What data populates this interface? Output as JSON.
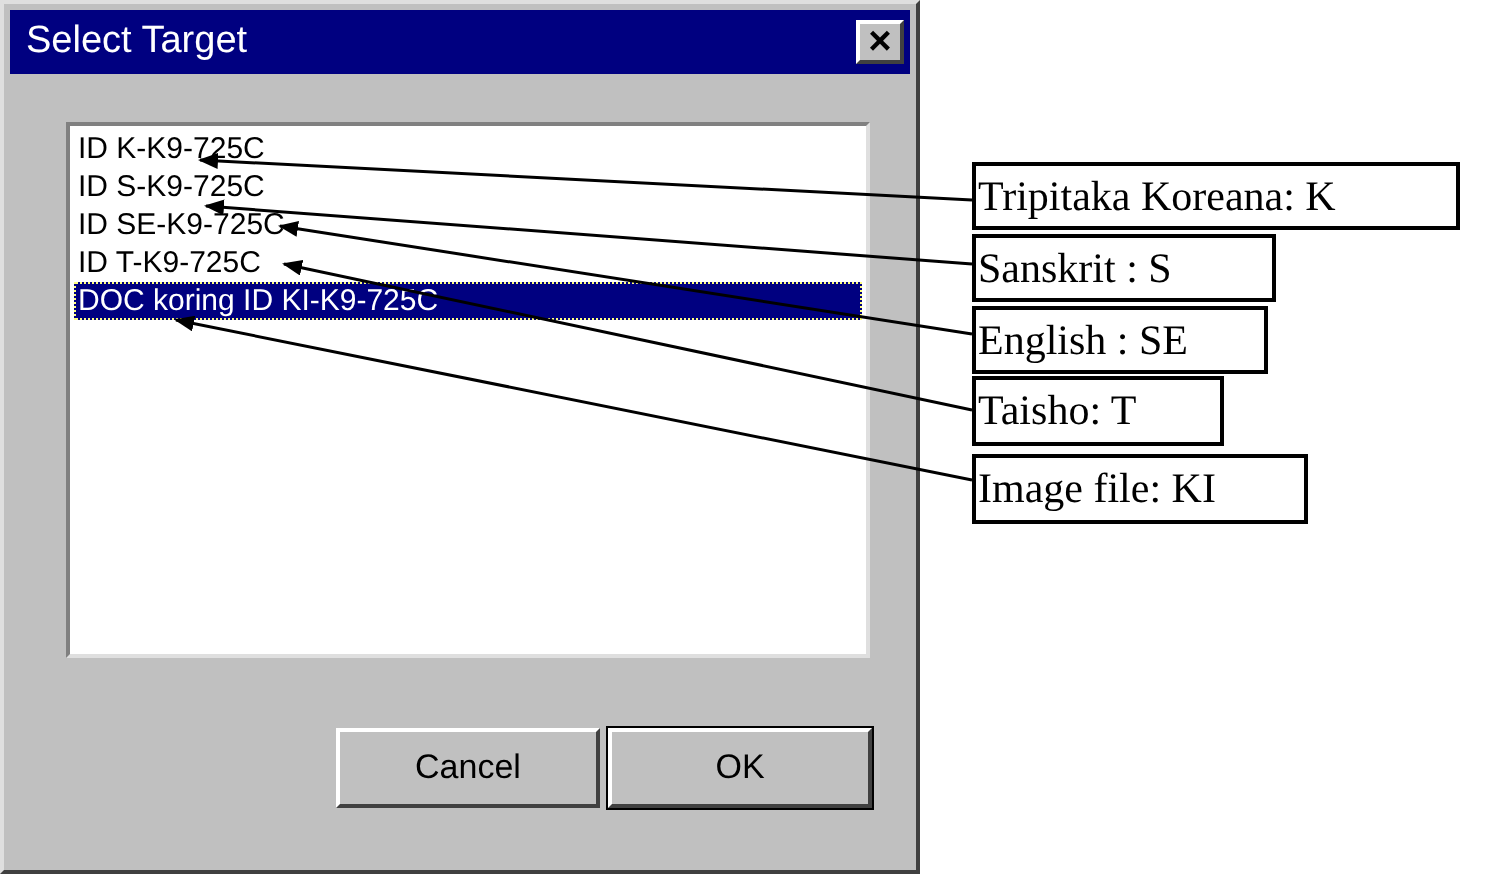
{
  "window": {
    "title": "Select Target",
    "close": "×"
  },
  "list": {
    "items": [
      {
        "label": "ID K-K9-725C",
        "selected": false
      },
      {
        "label": "ID S-K9-725C",
        "selected": false
      },
      {
        "label": "ID SE-K9-725C",
        "selected": false
      },
      {
        "label": "ID T-K9-725C",
        "selected": false
      },
      {
        "label": "DOC koring ID KI-K9-725C",
        "selected": true
      }
    ]
  },
  "buttons": [
    {
      "label": "Cancel",
      "default": false
    },
    {
      "label": "OK",
      "default": true
    }
  ],
  "callouts": [
    {
      "label": "Tripitaka Koreana: K"
    },
    {
      "label": "Sanskrit : S"
    },
    {
      "label": "English : SE"
    },
    {
      "label": "Taisho: T"
    },
    {
      "label": "Image file: KI"
    }
  ]
}
